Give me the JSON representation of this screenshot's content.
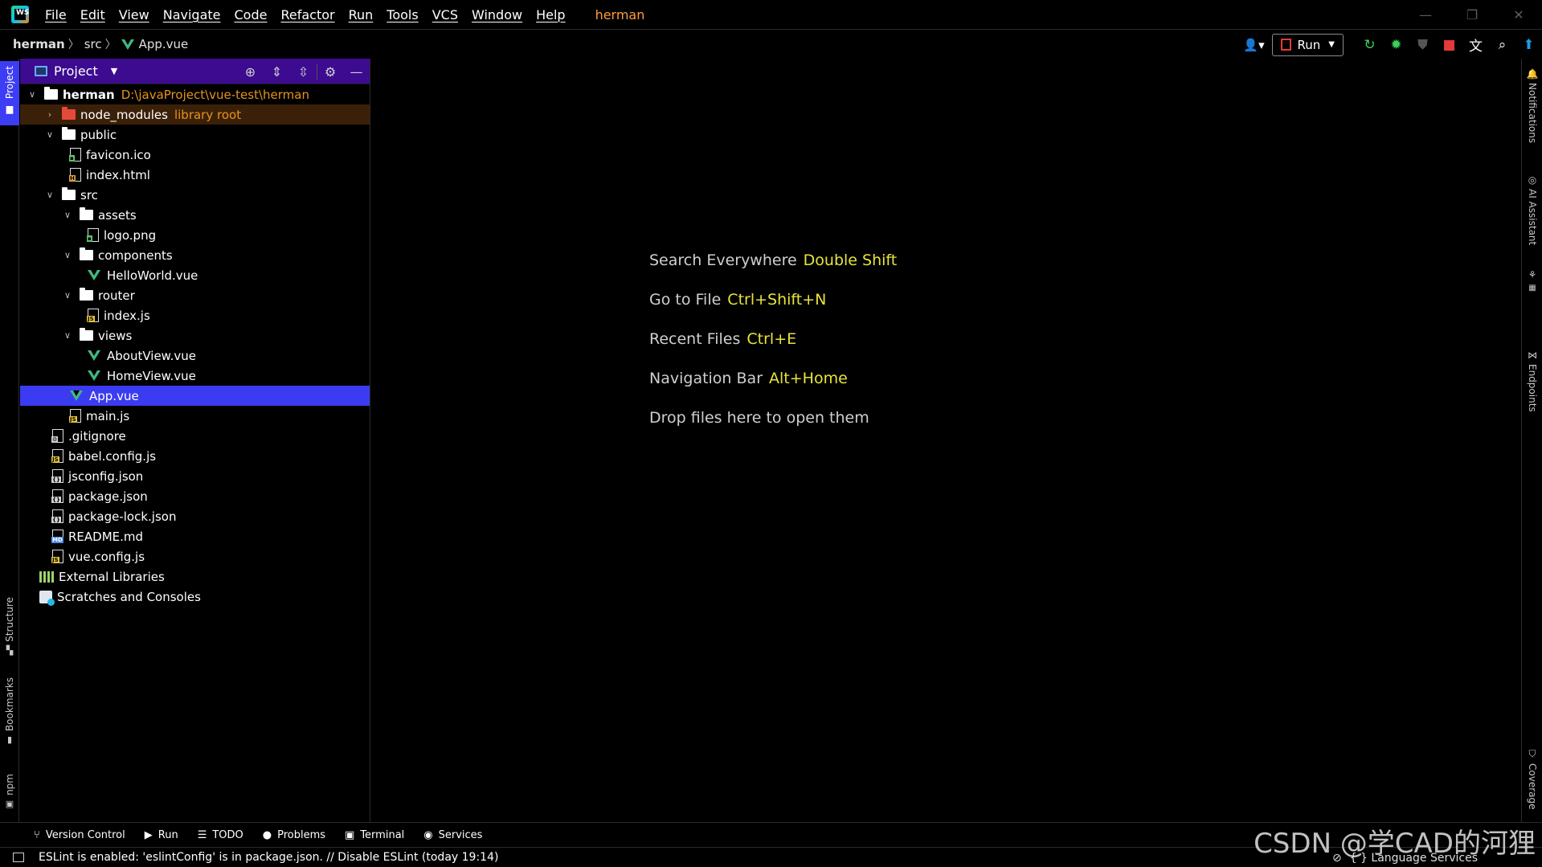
{
  "titlebar": {
    "menu": [
      "File",
      "Edit",
      "View",
      "Navigate",
      "Code",
      "Refactor",
      "Run",
      "Tools",
      "VCS",
      "Window",
      "Help"
    ],
    "project_name": "herman",
    "minimize": "—",
    "restore": "❐",
    "close": "✕"
  },
  "breadcrumb": {
    "root": "herman",
    "folder": "src",
    "file": "App.vue"
  },
  "toolbar": {
    "run_config_label": "Run"
  },
  "left_stripe": {
    "project": "Project",
    "structure": "Structure",
    "bookmarks": "Bookmarks",
    "npm": "npm"
  },
  "right_stripe": {
    "notifications": "Notifications",
    "ai_assistant": "AI Assistant",
    "endpoints": "Endpoints",
    "coverage": "Coverage"
  },
  "project_panel": {
    "title": "Project",
    "tree": [
      {
        "label": "herman",
        "hint": "D:\\javaProject\\vue-test\\herman",
        "type": "folder"
      },
      {
        "label": "node_modules",
        "hint": "library root",
        "type": "folder-lib"
      },
      {
        "label": "public",
        "type": "folder"
      },
      {
        "label": "favicon.ico",
        "type": "file"
      },
      {
        "label": "index.html",
        "type": "file"
      },
      {
        "label": "src",
        "type": "folder"
      },
      {
        "label": "assets",
        "type": "folder"
      },
      {
        "label": "logo.png",
        "type": "file"
      },
      {
        "label": "components",
        "type": "folder"
      },
      {
        "label": "HelloWorld.vue",
        "type": "vue"
      },
      {
        "label": "router",
        "type": "folder"
      },
      {
        "label": "index.js",
        "type": "file"
      },
      {
        "label": "views",
        "type": "folder"
      },
      {
        "label": "AboutView.vue",
        "type": "vue"
      },
      {
        "label": "HomeView.vue",
        "type": "vue"
      },
      {
        "label": "App.vue",
        "type": "vue"
      },
      {
        "label": "main.js",
        "type": "file"
      },
      {
        "label": ".gitignore",
        "type": "file"
      },
      {
        "label": "babel.config.js",
        "type": "file"
      },
      {
        "label": "jsconfig.json",
        "type": "file"
      },
      {
        "label": "package.json",
        "type": "file"
      },
      {
        "label": "package-lock.json",
        "type": "file"
      },
      {
        "label": "README.md",
        "type": "file"
      },
      {
        "label": "vue.config.js",
        "type": "file"
      },
      {
        "label": "External Libraries",
        "type": "lib"
      },
      {
        "label": "Scratches and Consoles",
        "type": "scratch"
      }
    ]
  },
  "editor_hints": [
    {
      "text": "Search Everywhere",
      "key": "Double Shift"
    },
    {
      "text": "Go to File",
      "key": "Ctrl+Shift+N"
    },
    {
      "text": "Recent Files",
      "key": "Ctrl+E"
    },
    {
      "text": "Navigation Bar",
      "key": "Alt+Home"
    },
    {
      "text": "Drop files here to open them",
      "key": ""
    }
  ],
  "bottom_tools": [
    "Version Control",
    "Run",
    "TODO",
    "Problems",
    "Terminal",
    "Services"
  ],
  "status": {
    "message": "ESLint is enabled: 'eslintConfig' is in package.json. // Disable ESLint (today 19:14)",
    "language_services": "{ } Language Services"
  },
  "watermark": "CSDN @学CAD的河狸"
}
